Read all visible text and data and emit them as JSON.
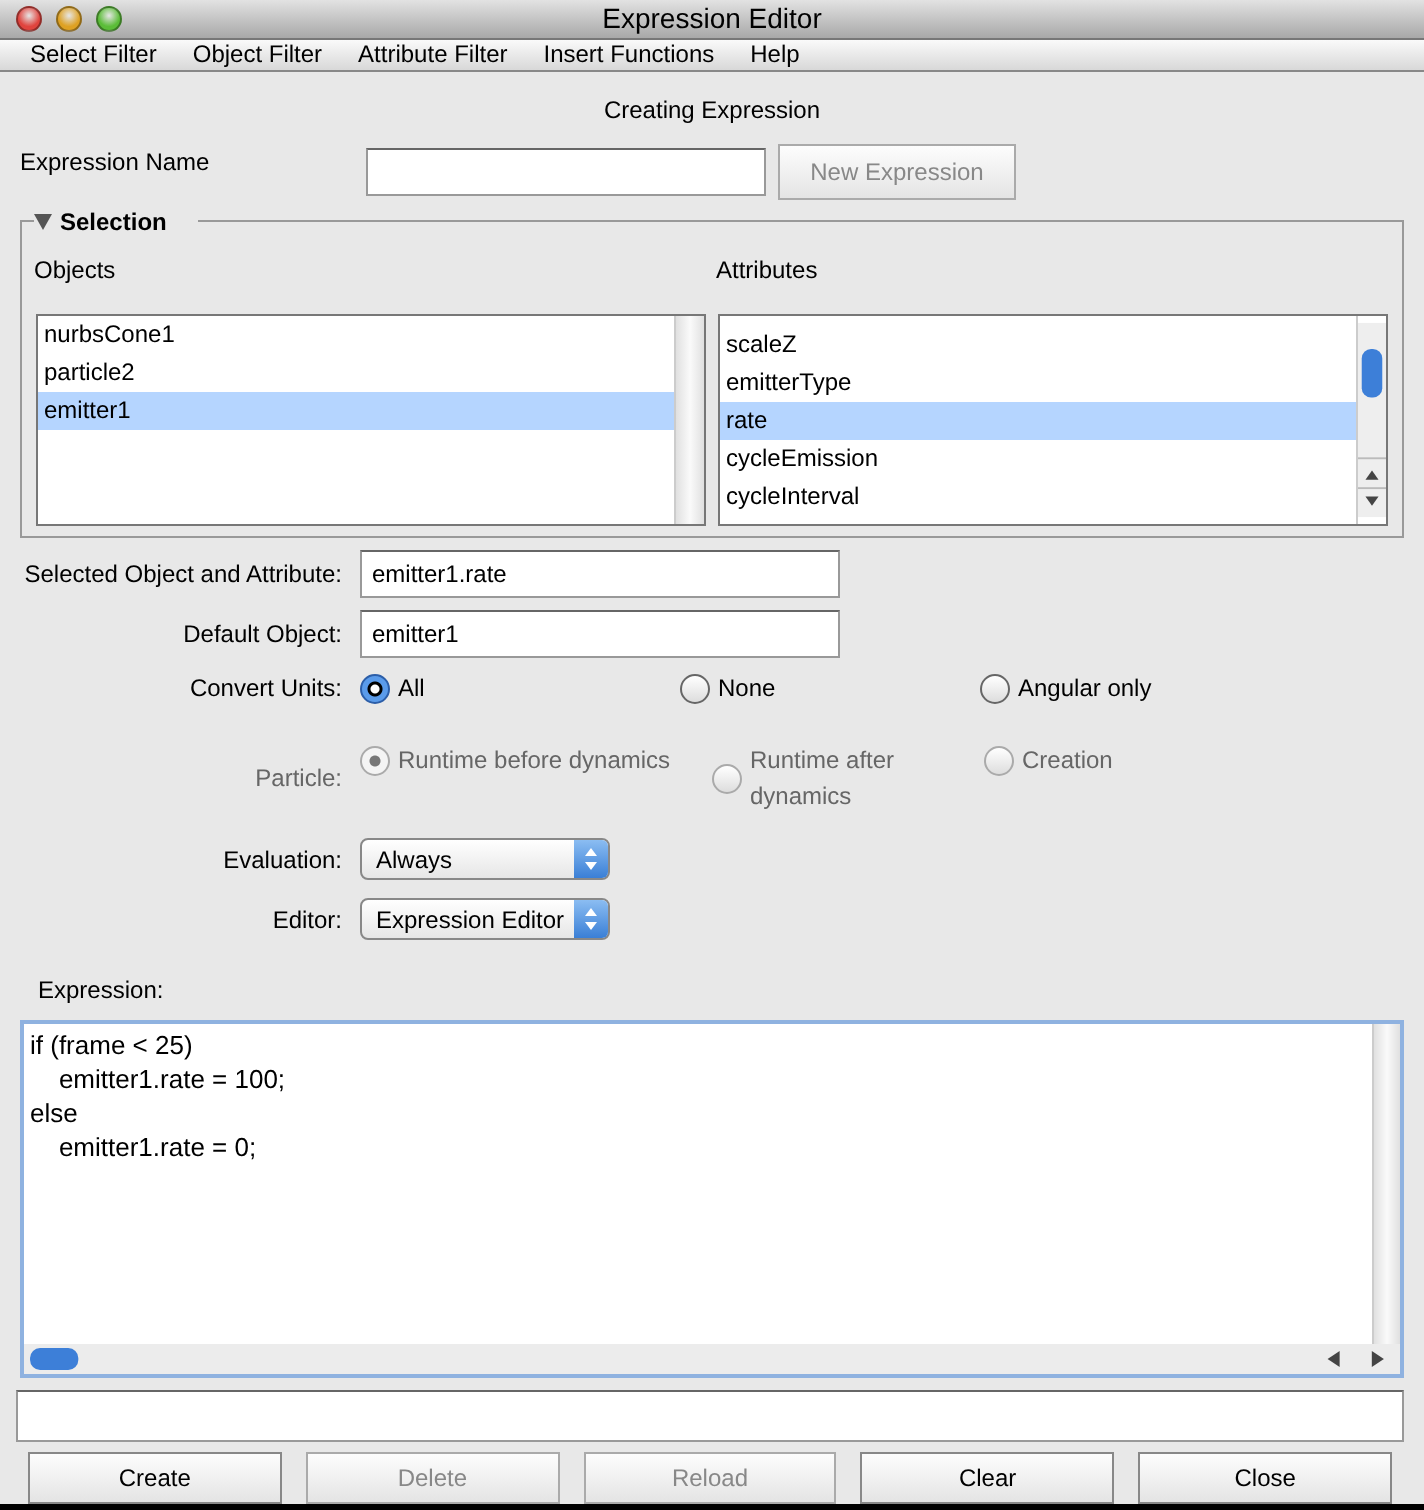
{
  "window": {
    "title": "Expression Editor"
  },
  "menu": [
    "Select Filter",
    "Object Filter",
    "Attribute Filter",
    "Insert Functions",
    "Help"
  ],
  "heading": "Creating Expression",
  "expression_name": {
    "label": "Expression Name"
  },
  "new_button": {
    "label": "New Expression",
    "disabled": true
  },
  "selection": {
    "title": "Selection",
    "expanded": true,
    "objects": {
      "label": "Objects",
      "items": [
        {
          "label": "nurbsCone1",
          "selected": false
        },
        {
          "label": "particle2",
          "selected": false
        },
        {
          "label": "emitter1",
          "selected": true
        }
      ]
    },
    "attributes": {
      "label": "Attributes",
      "items": [
        {
          "label": "scaleZ",
          "selected": false
        },
        {
          "label": "emitterType",
          "selected": false
        },
        {
          "label": "rate",
          "selected": true
        },
        {
          "label": "cycleEmission",
          "selected": false
        },
        {
          "label": "cycleInterval",
          "selected": false
        }
      ]
    }
  },
  "fields": [
    {
      "label": "Selected Object and Attribute:",
      "value": "emitter1.rate"
    },
    {
      "label": "Default Object:",
      "value": "emitter1"
    }
  ],
  "radio_groups": [
    {
      "label": "Convert Units:",
      "disabled": false,
      "options": [
        {
          "label": "All",
          "selected": true
        },
        {
          "label": "None",
          "selected": false
        },
        {
          "label": "Angular only",
          "selected": false
        }
      ]
    },
    {
      "label": "Particle:",
      "disabled": true,
      "options": [
        {
          "label": "Runtime before dynamics",
          "selected": true
        },
        {
          "label": "Runtime after dynamics",
          "selected": false
        },
        {
          "label": "Creation",
          "selected": false
        }
      ]
    }
  ],
  "dropdowns": [
    {
      "label": "Evaluation:",
      "value": "Always"
    },
    {
      "label": "Editor:",
      "value": "Expression Editor"
    }
  ],
  "expression": {
    "label": "Expression:",
    "lines": [
      "if (frame < 25)",
      "\temitter1.rate = 100;",
      "else",
      "\temitter1.rate = 0;"
    ]
  },
  "buttons": [
    {
      "label": "Create",
      "disabled": false
    },
    {
      "label": "Delete",
      "disabled": true
    },
    {
      "label": "Reload",
      "disabled": true
    },
    {
      "label": "Clear",
      "disabled": false
    },
    {
      "label": "Close",
      "disabled": false
    }
  ]
}
